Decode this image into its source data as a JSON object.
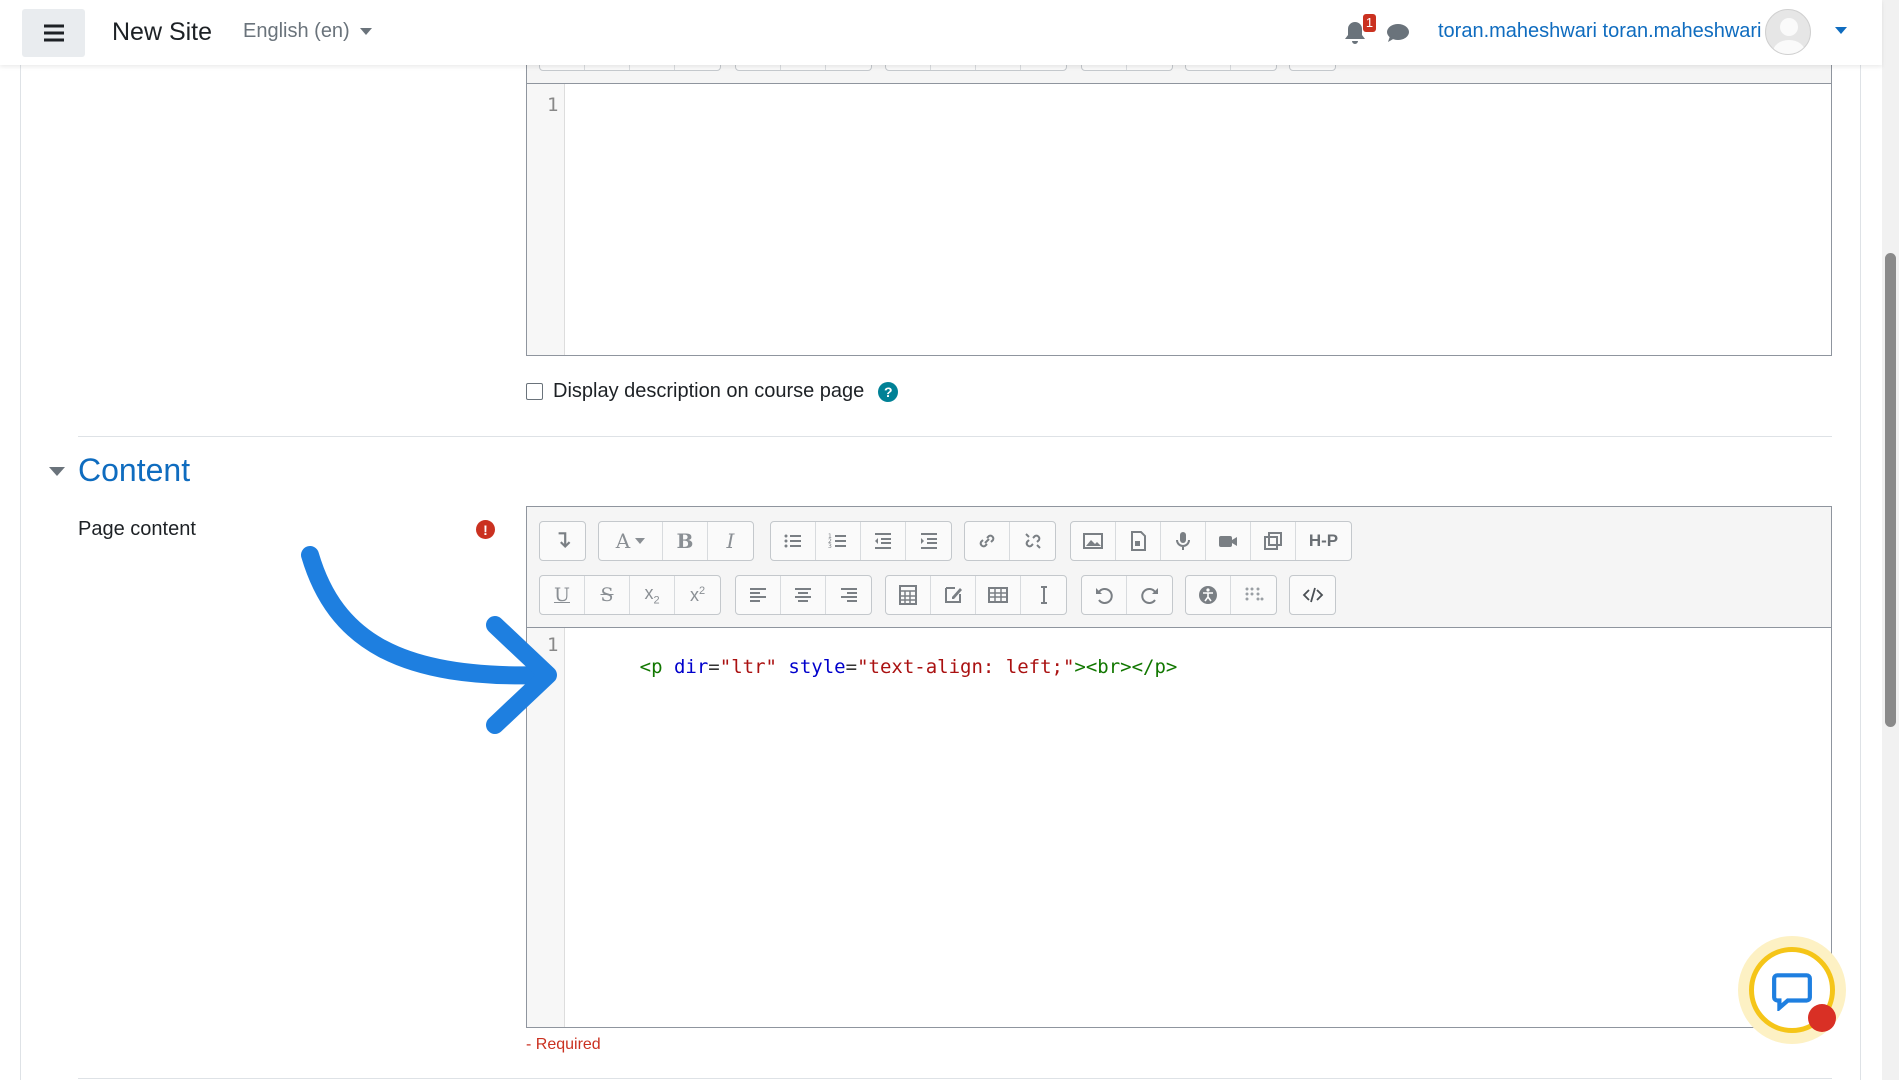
{
  "navbar": {
    "site_name": "New Site",
    "language": "English (en)",
    "notification_count": "1",
    "username": "toran.maheshwari toran.maheshwari"
  },
  "description_editor": {
    "line_numbers": [
      "1"
    ]
  },
  "display_description": {
    "label": "Display description on course page",
    "checked": false
  },
  "content_section": {
    "title": "Content",
    "page_content_label": "Page content",
    "required_text": "- Required",
    "line_numbers": [
      "1"
    ],
    "code_tokens": [
      {
        "text": "<p ",
        "type": "tag"
      },
      {
        "text": "dir",
        "type": "attr"
      },
      {
        "text": "=",
        "type": "op"
      },
      {
        "text": "\"ltr\"",
        "type": "str"
      },
      {
        "text": " ",
        "type": "op"
      },
      {
        "text": "style",
        "type": "attr"
      },
      {
        "text": "=",
        "type": "op"
      },
      {
        "text": "\"text-align: left;\"",
        "type": "str"
      },
      {
        "text": "><br></p>",
        "type": "tag"
      }
    ],
    "toolbar_row1": [
      [
        "collapse-icon"
      ],
      [
        "font-color-icon",
        "bold-icon",
        "italic-icon"
      ],
      [
        "unordered-list-icon",
        "ordered-list-icon",
        "outdent-icon",
        "indent-icon"
      ],
      [
        "link-icon",
        "unlink-icon"
      ],
      [
        "image-icon",
        "media-icon",
        "record-audio-icon",
        "record-video-icon",
        "manage-files-icon",
        "h5p-icon"
      ]
    ],
    "toolbar_row2": [
      [
        "underline-icon",
        "strikethrough-icon",
        "subscript-icon",
        "superscript-icon"
      ],
      [
        "align-left-icon",
        "align-center-icon",
        "align-right-icon"
      ],
      [
        "equation-icon",
        "special-chars-icon",
        "table-icon",
        "clear-formatting-icon"
      ],
      [
        "undo-icon",
        "redo-icon"
      ],
      [
        "accessibility-checker-icon",
        "screenreader-helper-icon"
      ],
      [
        "html-toggle-icon"
      ]
    ]
  },
  "colors": {
    "accent": "#0f6cbf",
    "danger": "#ca3120",
    "annotation_arrow": "#1e7fe0"
  }
}
